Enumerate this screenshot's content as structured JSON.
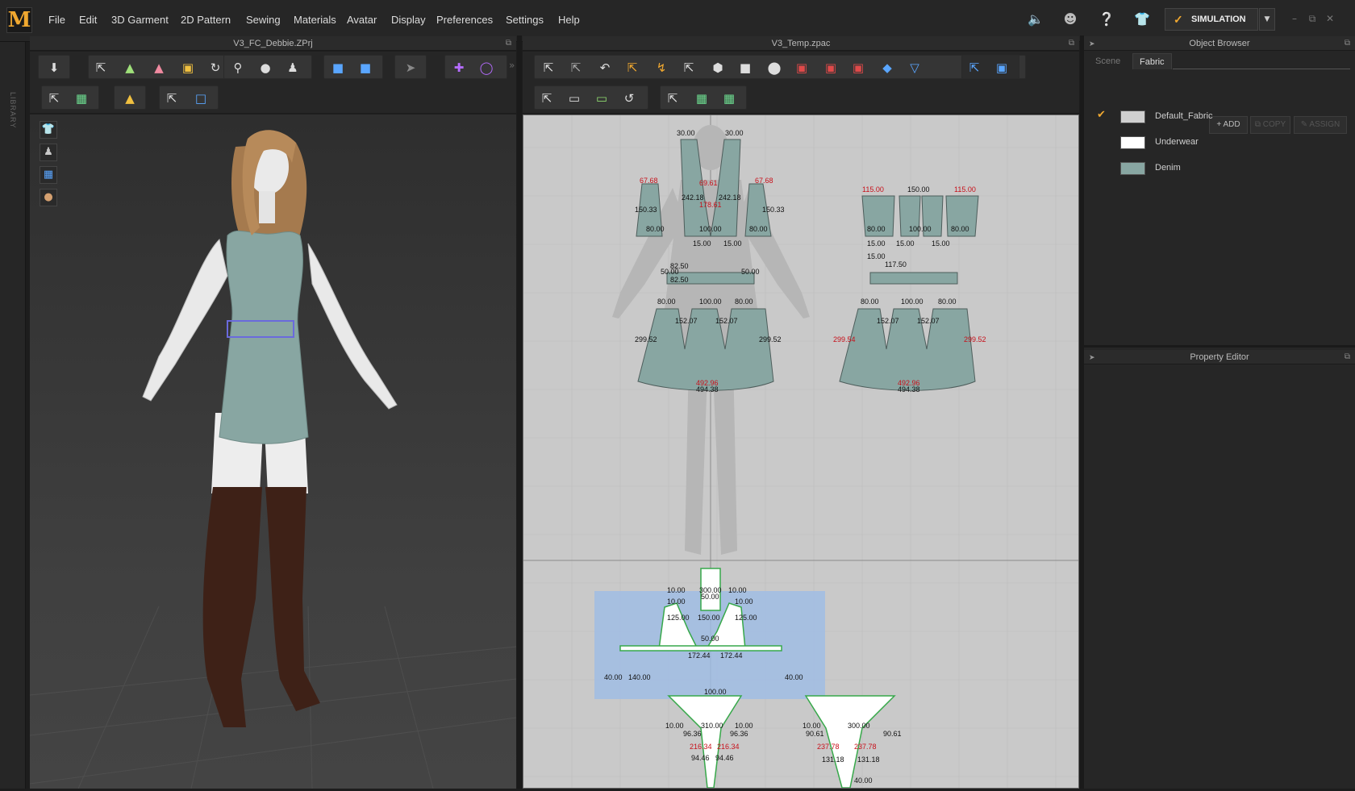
{
  "app": {
    "logo": "M",
    "menu": [
      "File",
      "Edit",
      "3D Garment",
      "2D Pattern",
      "Sewing",
      "Materials",
      "Avatar",
      "Display",
      "Preferences",
      "Settings",
      "Help"
    ],
    "simulation_label": "SIMULATION",
    "library_label": "LIBRARY"
  },
  "panels": {
    "view3d_title": "V3_FC_Debbie.ZPrj",
    "view2d_title": "V3_Temp.zpac",
    "object_browser_title": "Object Browser",
    "property_editor_title": "Property Editor"
  },
  "object_browser": {
    "tabs": [
      "Scene",
      "Fabric"
    ],
    "active_tab": "Fabric",
    "buttons": {
      "add": "ADD",
      "copy": "COPY",
      "assign": "ASSIGN"
    },
    "fabrics": [
      {
        "name": "Default_Fabric",
        "color": "#d0d0d0",
        "selected": true
      },
      {
        "name": "Underwear",
        "color": "#ffffff",
        "selected": false
      },
      {
        "name": "Denim",
        "color": "#88a6a2",
        "selected": false
      }
    ]
  },
  "pattern_labels": {
    "bodice": [
      "30.00",
      "30.00",
      "67.68",
      "67.68",
      "150.33",
      "150.33",
      "80.00",
      "100.00",
      "80.00",
      "242.18",
      "242.18",
      "178.61",
      "69.61"
    ],
    "back": [
      "115.00",
      "150.00",
      "115.00",
      "80.00",
      "100.00",
      "80.00"
    ],
    "belt": [
      "15.00",
      "15.00",
      "82.50",
      "50.00",
      "50.00",
      "82.50"
    ],
    "belt_back": [
      "15.00",
      "15.00",
      "15.00",
      "15.00",
      "117.50"
    ],
    "skirt_front": [
      "80.00",
      "100.00",
      "80.00",
      "152.07",
      "152.07",
      "299.52",
      "299.52",
      "492.96",
      "494.38"
    ],
    "skirt_back": [
      "80.00",
      "100.00",
      "80.00",
      "152.07",
      "152.07",
      "299.54",
      "299.52",
      "492.96",
      "494.38"
    ],
    "underwear_top": [
      "10.00",
      "10.00",
      "300.00",
      "10.00",
      "10.00",
      "150.00",
      "125.00",
      "125.00",
      "50.00",
      "50.00",
      "172.44",
      "172.44",
      "40.00",
      "140.00",
      "40.00",
      "100.00"
    ],
    "underwear_bottom": [
      "10.00",
      "310.00",
      "10.00",
      "300.00",
      "10.00",
      "96.36",
      "96.36",
      "216.34",
      "216.34",
      "237.78",
      "237.78",
      "90.61",
      "90.61",
      "131.18",
      "131.18",
      "94.46",
      "94.46",
      "40.00"
    ]
  },
  "colors": {
    "accent": "#f0a830",
    "pattern_fill": "#88a6a2",
    "pattern_stroke": "#4d5d5b",
    "selection": "#9dbde6",
    "label_red": "#c8101a"
  }
}
